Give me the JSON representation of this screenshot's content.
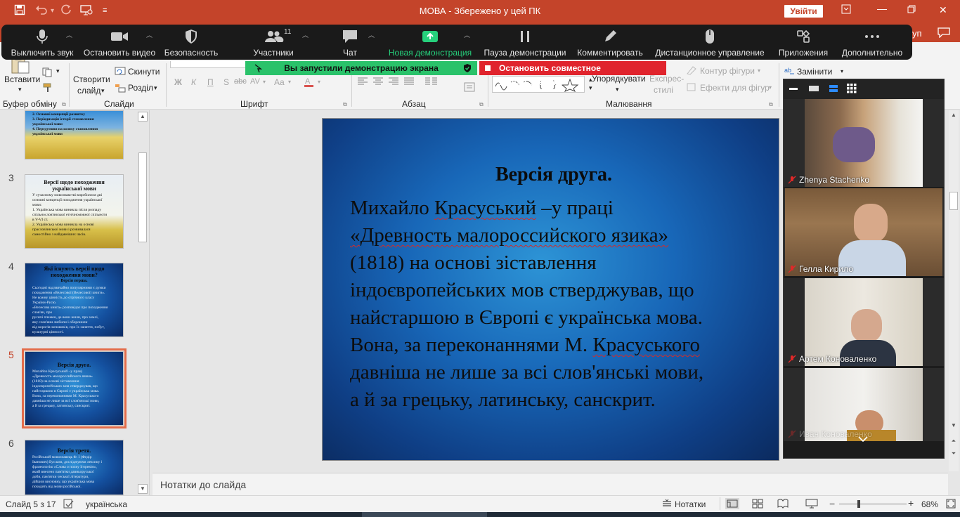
{
  "titlebar": {
    "doc_title": "МОВА  -  Збережено у цей ПК",
    "signin_label": "Увійти"
  },
  "zoom_toolbar": {
    "mute": "Выключить звук",
    "stop_video": "Остановить видео",
    "security": "Безопасность",
    "participants": "Участники",
    "participants_count": "11",
    "chat": "Чат",
    "new_share": "Новая демонстрация",
    "pause_share": "Пауза демонстрации",
    "annotate": "Комментировать",
    "remote_control": "Дистанционное управление",
    "apps": "Приложения",
    "more": "Дополнительно"
  },
  "share_banner": {
    "status": "Вы запустили демонстрацию экрана",
    "stop": "Остановить совместное использование"
  },
  "ribbon_share_fragment": "уп",
  "ribbon": {
    "paste": "Вставити",
    "new_slide": "Створити",
    "new_slide_2": "слайд",
    "reset": "Скинути",
    "section": "Розділ",
    "groups": {
      "clipboard": "Буфер обміну",
      "slides": "Слайди",
      "font": "Шрифт",
      "paragraph": "Абзац",
      "drawing": "Малювання"
    },
    "font_buttons": [
      "Ж",
      "К",
      "П",
      "S",
      "abc",
      "AV",
      "Aa"
    ],
    "arrange": "Упорядкувати",
    "quick_styles_1": "Експрес-",
    "quick_styles_2": "стилі",
    "shape_outline": "Контур фігури",
    "shape_effects": "Ефекти для фігур",
    "replace": "Замінити"
  },
  "thumbnails": [
    {
      "num": "",
      "title": "",
      "lines": [
        "2.  Основні концепції розвитку",
        "3.  Періодизація історії становлення",
        "     української мови",
        "4.  Передумови на шляху становлення",
        "     української мови"
      ],
      "style": "yellow"
    },
    {
      "num": "3",
      "title": "Версії щодо походження української мови",
      "lines": [
        "У сучасному мовознавстві виробилися дві",
        "основні концепції походження української",
        "мови:",
        "1.  Українська мова виникла після розпаду",
        "спільнослов'янської етнічномовної спільноти",
        "в V-VI ст.",
        "2.  Українська мова виникла на основі",
        "праслов'янської мови і розвивалася",
        "самостійно з найдавніших часів."
      ],
      "style": "field"
    },
    {
      "num": "4",
      "title": "Які існують версії щодо походження мови?",
      "subtitle": "Версія перша.",
      "lines": [
        "Сьогодні надзвичайно популярними є думки",
        "походження «Велесової (Велесової) книги».",
        "Не кожну цінність до отрічного класу",
        "України-Русю.",
        "«Велесова книга» розповідає про походження",
        "слов'ян, про",
        "русичі племен, де вони жили, про землі,",
        "яку слов'яни любили і оборонили",
        "від ворогів-кочовиків, про їх заняття, побут,",
        "культурні цінності."
      ],
      "style": "blue"
    },
    {
      "num": "5",
      "title": "Версія друга.",
      "lines": [
        "Михайло Красуський  –у праці",
        "«Древность малороссийского язика»",
        "(1818) на основі зіставлення",
        "індоєвропейських мов стверджував, що",
        "найстаршою в Європі є українська мова.",
        "Вона, за переконаннями М. Красуського",
        "давніша не лише за всі слов'янські мови,",
        "а й за грецьку, латинську, санскрит."
      ],
      "style": "blue"
    },
    {
      "num": "6",
      "title": "Версія третя.",
      "lines": [
        "Російський мовознавець Ф. І (Федір",
        "Іванович) Буслаєв, досліджуючи лексику і",
        "фразеологію «Слова о полку Ігоревім»,",
        "який внесено пам'ятки давньоруської",
        "доби, пам'ятки чеської літератури,",
        "дійшов висновку, що українська мова",
        "походить від мови російської."
      ],
      "style": "blue"
    }
  ],
  "slide": {
    "title": "Версія друга.",
    "line1a": "Михайло ",
    "line1b": "Красуський",
    "line1c": " –у праці",
    "line2": "«Древность малороссийского язика»",
    "line3": "(1818) на основі зіставлення",
    "line4": "індоєвропейських мов стверджував, що",
    "line5": "найстаршою в Європі є українська мова.",
    "line6a": "Вона, за переконаннями М. ",
    "line6b": "Красуського",
    "line7": "давніша не лише за всі слов'янські мови,",
    "line8": "а й за грецьку, латинську, санскрит."
  },
  "notes_placeholder": "Нотатки до слайда",
  "statusbar": {
    "slide_of": "Слайд 5 з 17",
    "language": "українська",
    "notes": "Нотатки",
    "zoom": "68%"
  },
  "gallery": {
    "participants": [
      {
        "name": "Zhenya Stachenko"
      },
      {
        "name": "Гелла Кирило"
      },
      {
        "name": "Артем Коноваленко"
      },
      {
        "name": "Иван Коноваленко"
      }
    ]
  },
  "colors": {
    "office_accent": "#c4442a",
    "zoom_green": "#26d07c",
    "banner_green": "#2ac26a",
    "banner_red": "#e0242d"
  }
}
